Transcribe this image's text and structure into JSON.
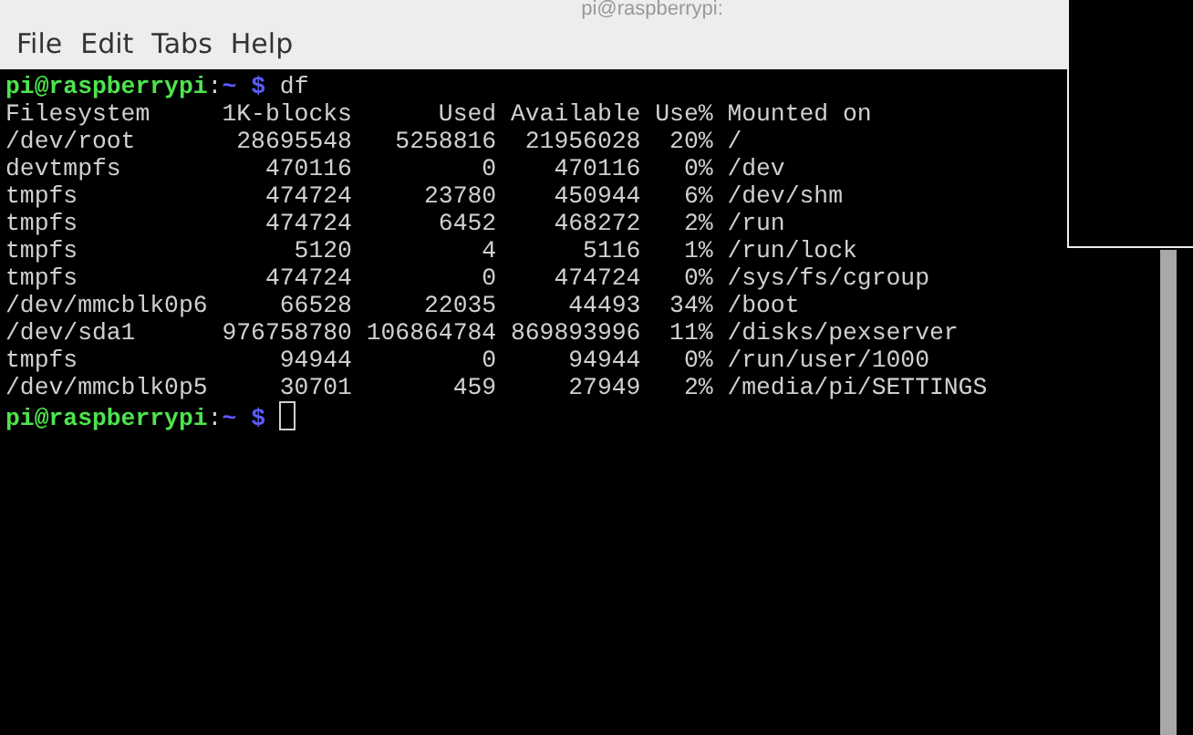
{
  "window": {
    "title": "pi@raspberrypi:"
  },
  "menu": [
    "File",
    "Edit",
    "Tabs",
    "Help"
  ],
  "terminal": {
    "lines": [
      {
        "kind": "prompt",
        "user_host": "pi@raspberrypi",
        "separator": ":",
        "path": "~",
        "symbol": "$",
        "command": "df",
        "cursor": false
      },
      {
        "kind": "output",
        "text": "Filesystem     1K-blocks      Used Available Use% Mounted on"
      },
      {
        "kind": "output",
        "text": "/dev/root       28695548   5258816  21956028  20% /"
      },
      {
        "kind": "output",
        "text": "devtmpfs          470116         0    470116   0% /dev"
      },
      {
        "kind": "output",
        "text": "tmpfs             474724     23780    450944   6% /dev/shm"
      },
      {
        "kind": "output",
        "text": "tmpfs             474724      6452    468272   2% /run"
      },
      {
        "kind": "output",
        "text": "tmpfs               5120         4      5116   1% /run/lock"
      },
      {
        "kind": "output",
        "text": "tmpfs             474724         0    474724   0% /sys/fs/cgroup"
      },
      {
        "kind": "output",
        "text": "/dev/mmcblk0p6     66528     22035     44493  34% /boot"
      },
      {
        "kind": "output",
        "text": "/dev/sda1      976758780 106864784 869893996  11% /disks/pexserver"
      },
      {
        "kind": "output",
        "text": "tmpfs              94944         0     94944   0% /run/user/1000"
      },
      {
        "kind": "output",
        "text": "/dev/mmcblk0p5     30701       459     27949   2% /media/pi/SETTINGS"
      },
      {
        "kind": "prompt",
        "user_host": "pi@raspberrypi",
        "separator": ":",
        "path": "~",
        "symbol": "$",
        "cursor": true
      }
    ]
  }
}
